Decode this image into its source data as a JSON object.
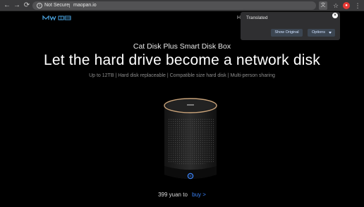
{
  "browser": {
    "back_label": "←",
    "forward_label": "→",
    "reload_label": "⟳",
    "security_label": "Not Secure",
    "url": "maopan.io",
    "info_glyph": "i",
    "translate_glyph": "文",
    "star_glyph": "☆",
    "menu_glyph": "⋮"
  },
  "header": {
    "nav_stub": "H"
  },
  "translate_popup": {
    "title": "Translated",
    "close_glyph": "×",
    "show_original_label": "Show Original",
    "options_label": "Options"
  },
  "hero": {
    "subtitle": "Cat Disk Plus Smart Disk Box",
    "headline": "Let the hard drive become a network disk",
    "features": "Up to 12TB | Hard disk replaceable | Compatible size hard disk | Multi-person sharing"
  },
  "purchase": {
    "price": "399 yuan to",
    "buy_label": "buy >"
  },
  "colors": {
    "background": "#000000",
    "accent_blue": "#3b82f6",
    "chrome": "#3a3a3c",
    "device_ring": "#c9a37a"
  }
}
